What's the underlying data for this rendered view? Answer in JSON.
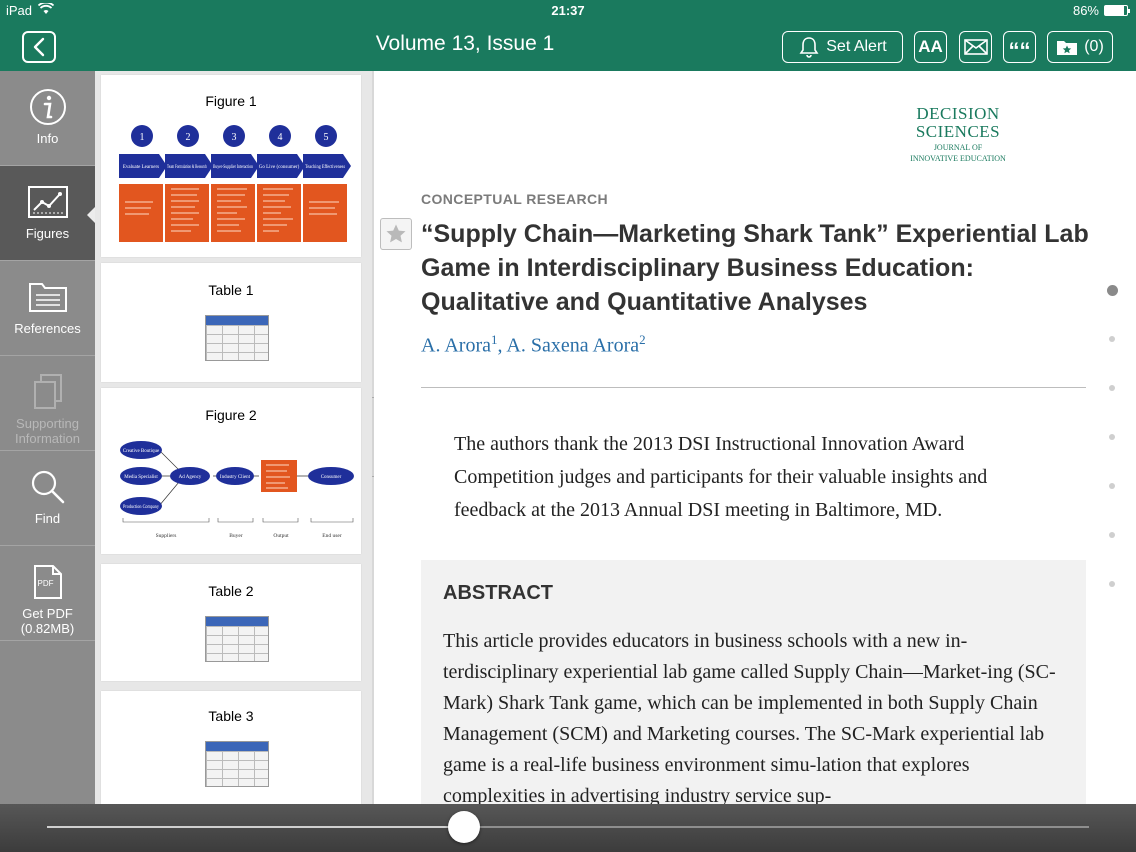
{
  "status_bar": {
    "device": "iPad",
    "time": "21:37",
    "battery": "86%",
    "battery_level": 0.86
  },
  "nav": {
    "title": "Volume 13, Issue 1",
    "set_alert": "Set Alert",
    "font_size": "AA",
    "quote_glyph": "““",
    "saved_count": "(0)",
    "accent_color": "#1a7a5e"
  },
  "sidebar": {
    "items": [
      {
        "label": "Info",
        "icon": "info-icon"
      },
      {
        "label": "Figures",
        "icon": "figures-icon"
      },
      {
        "label": "References",
        "icon": "references-icon"
      },
      {
        "label": "Supporting Information",
        "icon": "supporting-information-icon"
      },
      {
        "label": "Find",
        "icon": "search-icon"
      },
      {
        "label": "Get PDF (0.82MB)",
        "icon": "pdf-icon",
        "icon_text": "PDF"
      }
    ]
  },
  "figures": {
    "items": [
      {
        "label": "Figure 1",
        "steps": [
          "1",
          "2",
          "3",
          "4",
          "5"
        ],
        "stages": [
          "Evaluate Learners",
          "Team Formulation & Research",
          "Buyer-Supplier Interaction",
          "Go Live (consumer)",
          "Teaching Effectiveness"
        ]
      },
      {
        "label": "Table 1"
      },
      {
        "label": "Figure 2",
        "nodes": [
          "Creative Boutique",
          "Media Specialist",
          "Production Company",
          "Ad Agency",
          "Industry Client",
          "Consumer"
        ],
        "axis": [
          "Suppliers",
          "Buyer",
          "Output",
          "End user"
        ]
      },
      {
        "label": "Table 2"
      },
      {
        "label": "Table 3"
      }
    ]
  },
  "article": {
    "journal_logo_line1": "DECISION",
    "journal_logo_line2": "SCIENCES",
    "journal_logo_line3": "JOURNAL OF",
    "journal_logo_line4": "INNOVATIVE EDUCATION",
    "section": "CONCEPTUAL RESEARCH",
    "title": "“Supply Chain—Marketing Shark Tank” Experiential Lab Game in Interdisciplinary Business Education: Qualitative and Quantitative Analyses",
    "author1": "A. Arora",
    "author1_sup": "1",
    "author_sep": ", ",
    "author2": "A. Saxena Arora",
    "author2_sup": "2",
    "acknowledgement": "The authors thank the 2013 DSI Instructional Innovation Award Competition judges and participants for their valuable insights and feedback at the 2013 Annual DSI meeting in Baltimore, MD.",
    "abstract_heading": "ABSTRACT",
    "abstract_text": "This article provides educators in business schools with a new in-terdisciplinary experiential lab game called Supply Chain—Market-ing (SC-Mark) Shark Tank game, which can be implemented in both Supply Chain Management (SCM) and Marketing courses. The SC-Mark experiential lab game is a real-life business environment simu-lation that explores complexities in advertising industry service sup-"
  },
  "pager": {
    "pages": 7,
    "current_page": 1
  },
  "scrubber": {
    "progress": 0.4
  }
}
